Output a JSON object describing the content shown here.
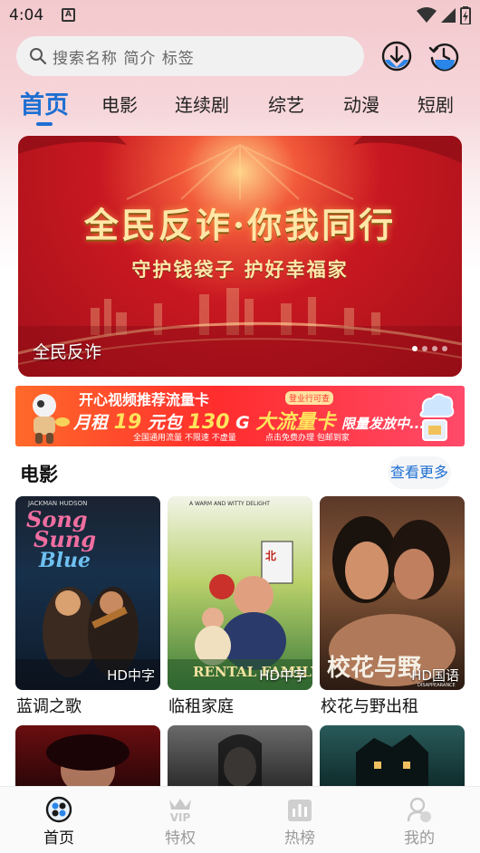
{
  "status_bar": {
    "time": "4:04",
    "notification_letter": "A"
  },
  "search": {
    "placeholder": "搜索名称 简介 标签"
  },
  "tabs": [
    {
      "label": "首页",
      "active": true
    },
    {
      "label": "电影"
    },
    {
      "label": "连续剧"
    },
    {
      "label": "综艺"
    },
    {
      "label": "动漫"
    },
    {
      "label": "短剧"
    }
  ],
  "banner": {
    "headline": "全民反诈·你我同行",
    "subline": "守护钱袋子 护好幸福家",
    "caption": "全民反诈"
  },
  "ad": {
    "title": "开心视频推荐流量卡",
    "badge": "登业行可查",
    "main_prefix": "月租",
    "price": "19",
    "main_mid": "元包",
    "data": "130",
    "unit": "G",
    "main_suffix": "大流量卡",
    "tail": "限量发放中......",
    "foot_left": "全国通用流量  不限速  不虚量",
    "foot_right": "点击免费办理  包邮到家"
  },
  "section": {
    "title": "电影",
    "more_label": "查看更多"
  },
  "movies": [
    {
      "title": "蓝调之歌",
      "badge": "HD中字",
      "poster_title": "Song Sung Blue",
      "poster_top": "JACKMAN   HUDSON"
    },
    {
      "title": "临租家庭",
      "badge": "HD中字",
      "poster_title": "RENTAL FAMILY",
      "poster_top": "A WARM AND WITTY DELIGHT"
    },
    {
      "title": "校花与野出租",
      "badge": "HD国语",
      "poster_title": "校花与野",
      "poster_top": "DISAPPEARANCE"
    }
  ],
  "bottom_nav": [
    {
      "label": "首页",
      "active": true
    },
    {
      "label": "特权",
      "icon_text": "VIP"
    },
    {
      "label": "热榜"
    },
    {
      "label": "我的"
    }
  ]
}
